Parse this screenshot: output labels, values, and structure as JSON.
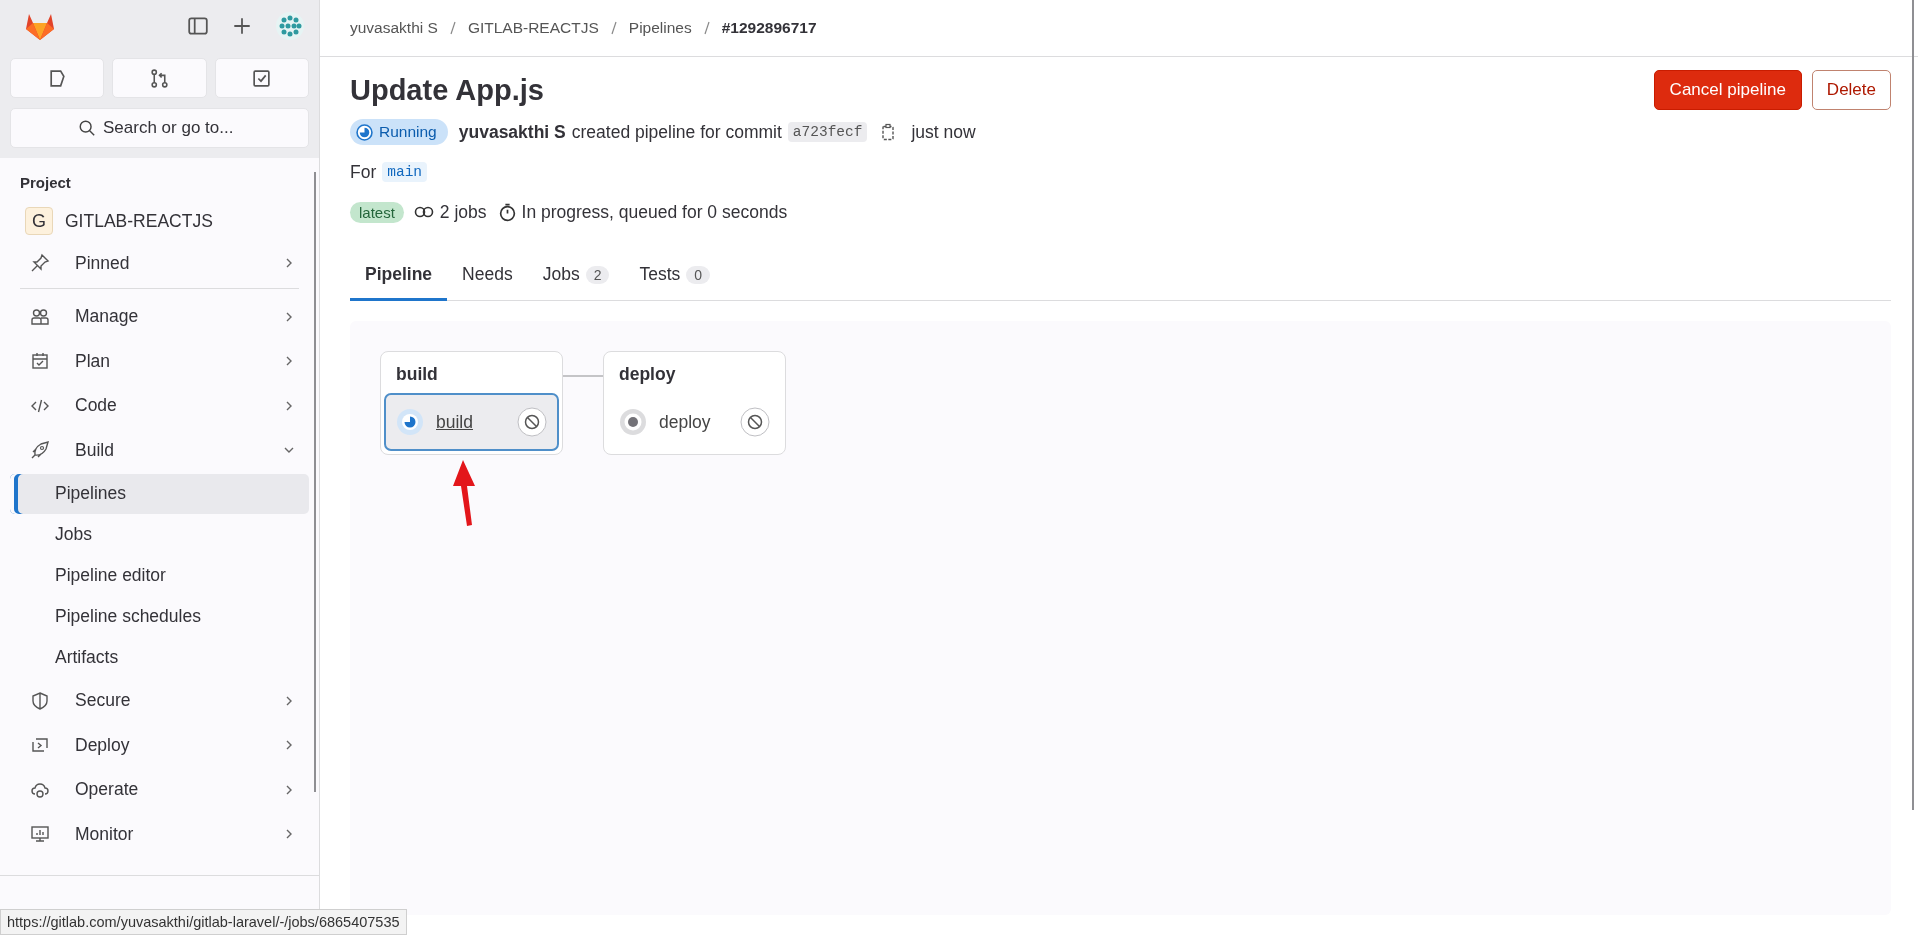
{
  "sidebar": {
    "search": {
      "placeholder": "Search or go to..."
    },
    "section_title": "Project",
    "project": {
      "initial": "G",
      "name": "GITLAB-REACTJS"
    },
    "items": [
      {
        "label": "Pinned",
        "expanded": false
      },
      {
        "label": "Manage",
        "expanded": false
      },
      {
        "label": "Plan",
        "expanded": false
      },
      {
        "label": "Code",
        "expanded": false
      },
      {
        "label": "Build",
        "expanded": true,
        "children": [
          {
            "label": "Pipelines",
            "selected": true
          },
          {
            "label": "Jobs",
            "selected": false
          },
          {
            "label": "Pipeline editor",
            "selected": false
          },
          {
            "label": "Pipeline schedules",
            "selected": false
          },
          {
            "label": "Artifacts",
            "selected": false
          }
        ]
      },
      {
        "label": "Secure",
        "expanded": false
      },
      {
        "label": "Deploy",
        "expanded": false
      },
      {
        "label": "Operate",
        "expanded": false
      },
      {
        "label": "Monitor",
        "expanded": false
      }
    ]
  },
  "breadcrumbs": [
    "yuvasakthi S",
    "GITLAB-REACTJS",
    "Pipelines",
    "#1292896717"
  ],
  "header": {
    "title": "Update App.js",
    "status": "Running",
    "author": "yuvasakthi S",
    "action": "created pipeline for commit",
    "commit": "a723fecf",
    "time": "just now",
    "ref_label": "For",
    "ref": "main",
    "badge": "latest",
    "jobs": "2 jobs",
    "duration": "In progress, queued for 0 seconds"
  },
  "buttons": {
    "cancel": "Cancel pipeline",
    "delete": "Delete"
  },
  "tabs": [
    {
      "label": "Pipeline",
      "selected": true
    },
    {
      "label": "Needs",
      "selected": false
    },
    {
      "label": "Jobs",
      "count": "2",
      "selected": false
    },
    {
      "label": "Tests",
      "count": "0",
      "selected": false
    }
  ],
  "stages": [
    {
      "name": "build",
      "jobs": [
        {
          "name": "build",
          "kind": "running",
          "hovered": true
        }
      ]
    },
    {
      "name": "deploy",
      "jobs": [
        {
          "name": "deploy",
          "kind": "created",
          "hovered": false
        }
      ]
    }
  ],
  "status_bar": {
    "url": "https://gitlab.com/yuvasakthi/gitlab-laravel/-/jobs/6865407535"
  }
}
